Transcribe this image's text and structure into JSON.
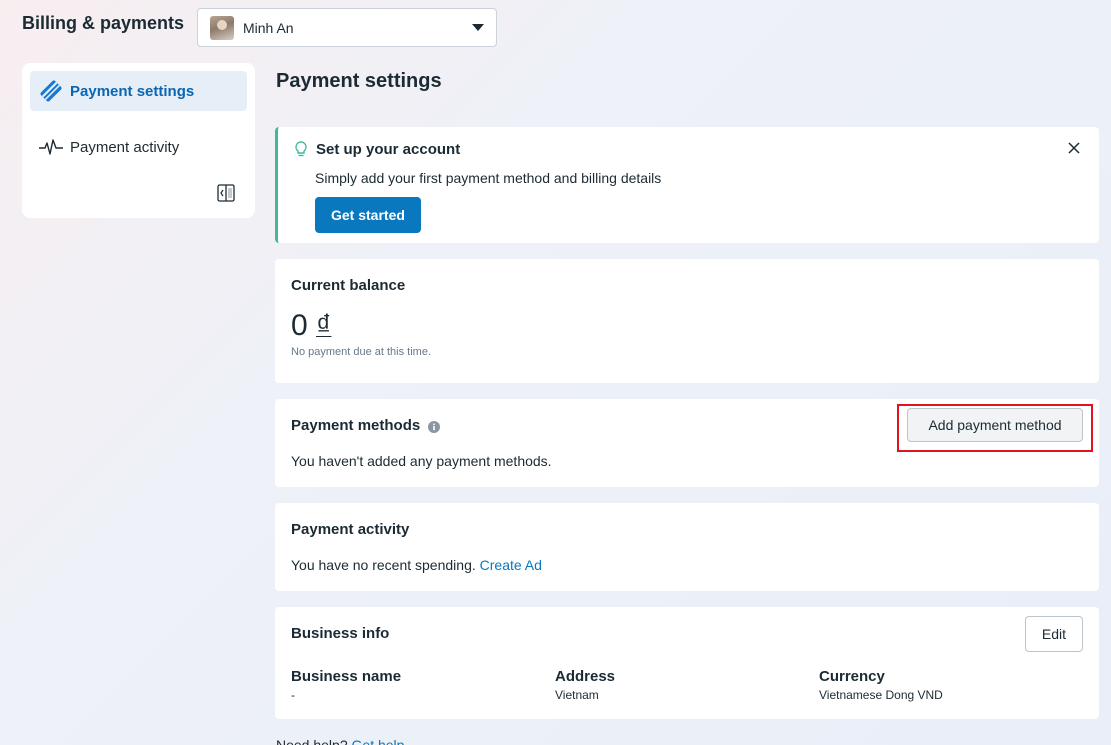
{
  "header": {
    "title": "Billing & payments",
    "account_name": "Minh An"
  },
  "sidebar": {
    "items": [
      {
        "label": "Payment settings",
        "icon": "credit-card-icon",
        "active": true
      },
      {
        "label": "Payment activity",
        "icon": "activity-pulse-icon",
        "active": false
      }
    ]
  },
  "main": {
    "page_title": "Payment settings",
    "setup": {
      "title": "Set up your account",
      "text": "Simply add your first payment method and billing details",
      "button": "Get started"
    },
    "balance": {
      "title": "Current balance",
      "amount": "0",
      "currency_symbol": "₫",
      "note": "No payment due at this time."
    },
    "payment_methods": {
      "title": "Payment methods",
      "button": "Add payment method",
      "empty_text": "You haven't added any payment methods."
    },
    "payment_activity": {
      "title": "Payment activity",
      "text": "You have no recent spending.",
      "link": "Create Ad"
    },
    "business_info": {
      "title": "Business info",
      "edit_button": "Edit",
      "fields": [
        {
          "label": "Business name",
          "value": "-"
        },
        {
          "label": "Address",
          "value": "Vietnam"
        },
        {
          "label": "Currency",
          "value": "Vietnamese Dong VND"
        }
      ]
    },
    "help": {
      "text": "Need help?",
      "link": "Get help"
    }
  },
  "colors": {
    "accent": "#0a78be",
    "active_nav": "#0a66b3",
    "setup_border": "#3fb89f",
    "highlight_frame": "#e0141e"
  }
}
